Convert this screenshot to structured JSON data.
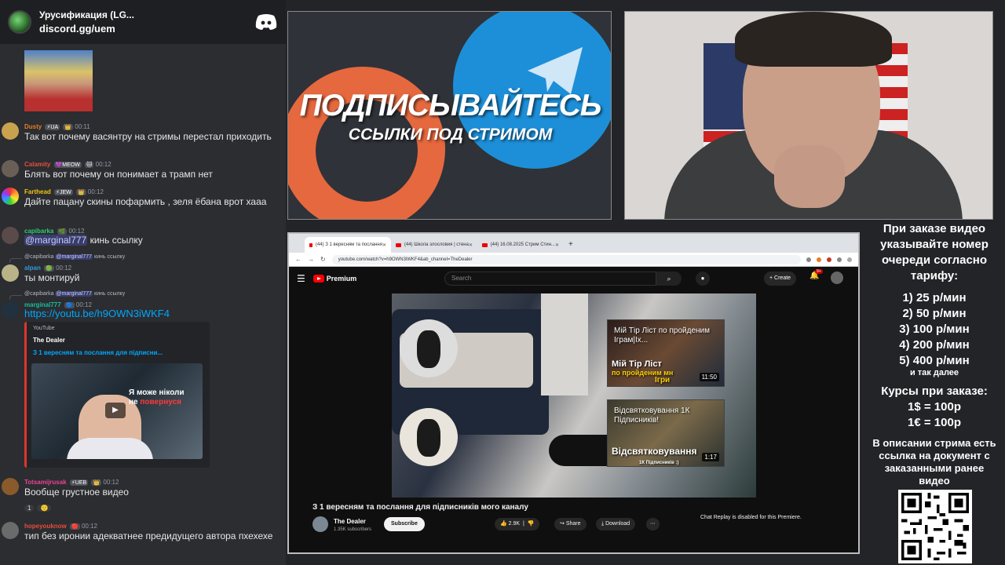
{
  "server": {
    "name": "Урусификация (LG...",
    "invite": "discord.gg/uem"
  },
  "chat": {
    "messages": [
      {
        "user": "Dusty",
        "badges": [
          "⚡UA",
          "👑"
        ],
        "time": "00:11",
        "text": "Так вот почему васянтру на стримы перестал приходить"
      },
      {
        "user": "Calamity",
        "badges": [
          "💜MEOW",
          "🐱"
        ],
        "time": "00:12",
        "text": "Блять вот почему он понимает а трамп нет"
      },
      {
        "user": "Farthead",
        "badges": [
          "⚡JEW",
          "👑"
        ],
        "time": "00:12",
        "text": "Дайте пацану скины пофармить , зеля ёбана врот хааа"
      },
      {
        "user": "capibarka",
        "badges": [
          "🌿"
        ],
        "time": "00:12",
        "mention": "@marginal777",
        "text": " кинь ссылку"
      },
      {
        "reply_user": "@capibarka",
        "reply_mention": "@marginal777",
        "reply_text": "кинь ссылку",
        "user": "alpan",
        "badges": [
          "🟢"
        ],
        "time": "00:12",
        "text": "ты монтируй"
      },
      {
        "reply_user": "@capibarka",
        "reply_mention": "@marginal777",
        "reply_text": "кинь ссылку",
        "user": "marginal777",
        "badges": [
          "🔵"
        ],
        "time": "00:12",
        "link": "https://youtu.be/h9OWN3iWKF4"
      },
      {
        "user": "Totsamijrusak",
        "badges": [
          "⚡UEB",
          "👑"
        ],
        "time": "00:12",
        "text": "Вообще грустное видео",
        "reactions": [
          "1",
          "🙂"
        ]
      },
      {
        "user": "hopeyouknow",
        "badges": [
          "🔴"
        ],
        "time": "00:12",
        "text": "тип без иронии адекватнее предидущего автора пхехехе"
      }
    ],
    "embed": {
      "provider": "YouTube",
      "author": "The Dealer",
      "title": "З 1 вересням та послання для підписни...",
      "overlay_a": "Я може ніколи",
      "overlay_b": "не",
      "overlay_red": "повернуся"
    }
  },
  "promo": {
    "title": "ПОДПИСЫВАЙТЕСЬ",
    "subtitle": "ССЫЛКИ ПОД СТРИМОМ"
  },
  "browser": {
    "tabs": [
      {
        "label": "(44) З 1 вересням та послання",
        "active": true
      },
      {
        "label": "(44) Школа злословия | стена",
        "active": false
      },
      {
        "label": "(44) 16.08.2025 Стрим Стин...",
        "active": false
      }
    ],
    "url": "youtube.com/watch?v=h9OWN3iWKF4&ab_channel=TheDealer"
  },
  "youtube": {
    "logo": "Premium",
    "search_placeholder": "Search",
    "create_label": "Create",
    "notif_count": "9+",
    "video_title": "З 1 вересням та послання для підписників мого каналу",
    "channel": "The Dealer",
    "subscribers": "1.35K subscribers",
    "subscribe_label": "Subscribe",
    "likes": "2.9K",
    "share_label": "Share",
    "download_label": "Download",
    "chat_replay": "Chat Replay is disabled for this Premiere.",
    "card1": {
      "caption": "Мій Тір Ліст по пройденим Іграм|Іх...",
      "big": "Мій Тір Ліст",
      "big2": "по пройденим мн",
      "big3": "Ігри",
      "duration": "11:50"
    },
    "card2": {
      "caption": "Відсвятковування 1К Підписників!",
      "big": "Відсвятковування",
      "small": "1К Підписників :)",
      "duration": "1:17"
    }
  },
  "info": {
    "order_note": "При заказе видео указывайте номер очереди согласно тарифу:",
    "tariffs": [
      "1) 25 р/мин",
      "2) 50 р/мин",
      "3) 100 р/мин",
      "4) 200 р/мин",
      "5) 400 р/мин"
    ],
    "etc": "и так далее",
    "rates_title": "Курсы при заказе:",
    "rates": [
      "1$ = 100р",
      "1€ = 100р"
    ],
    "description_note": "В описании стрима есть ссылка на документ с заказанными ранее видео"
  }
}
